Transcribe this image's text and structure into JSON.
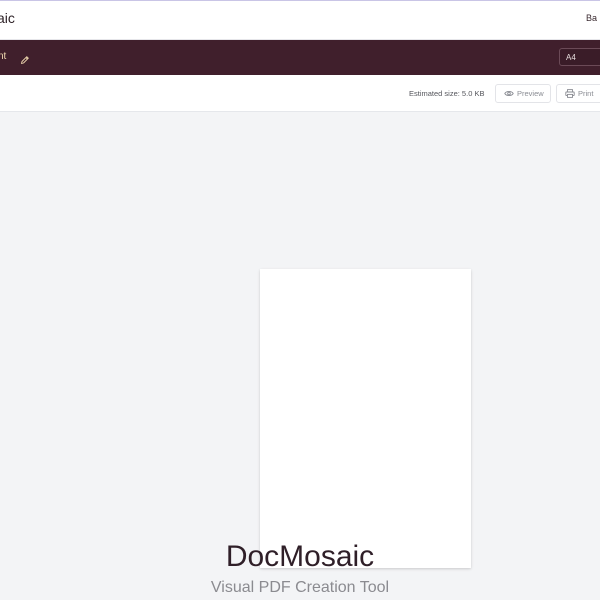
{
  "header": {
    "app_title": "aic",
    "back_label": "Ba"
  },
  "document_bar": {
    "title": "nt",
    "paper_size": "A4"
  },
  "toolbar": {
    "estimated_size": "Estimated size: 5.0 KB",
    "preview_label": "Preview",
    "print_label": "Print"
  },
  "branding": {
    "name": "DocMosaic",
    "tagline": "Visual PDF Creation Tool"
  },
  "colors": {
    "doc_bar": "#401f2c",
    "doc_title_text": "#f0d9b0",
    "canvas_bg": "#f3f4f6",
    "page_bg": "#ffffff"
  },
  "icons": {
    "rename": "pencil-icon",
    "preview": "eye-icon",
    "print": "printer-icon"
  }
}
